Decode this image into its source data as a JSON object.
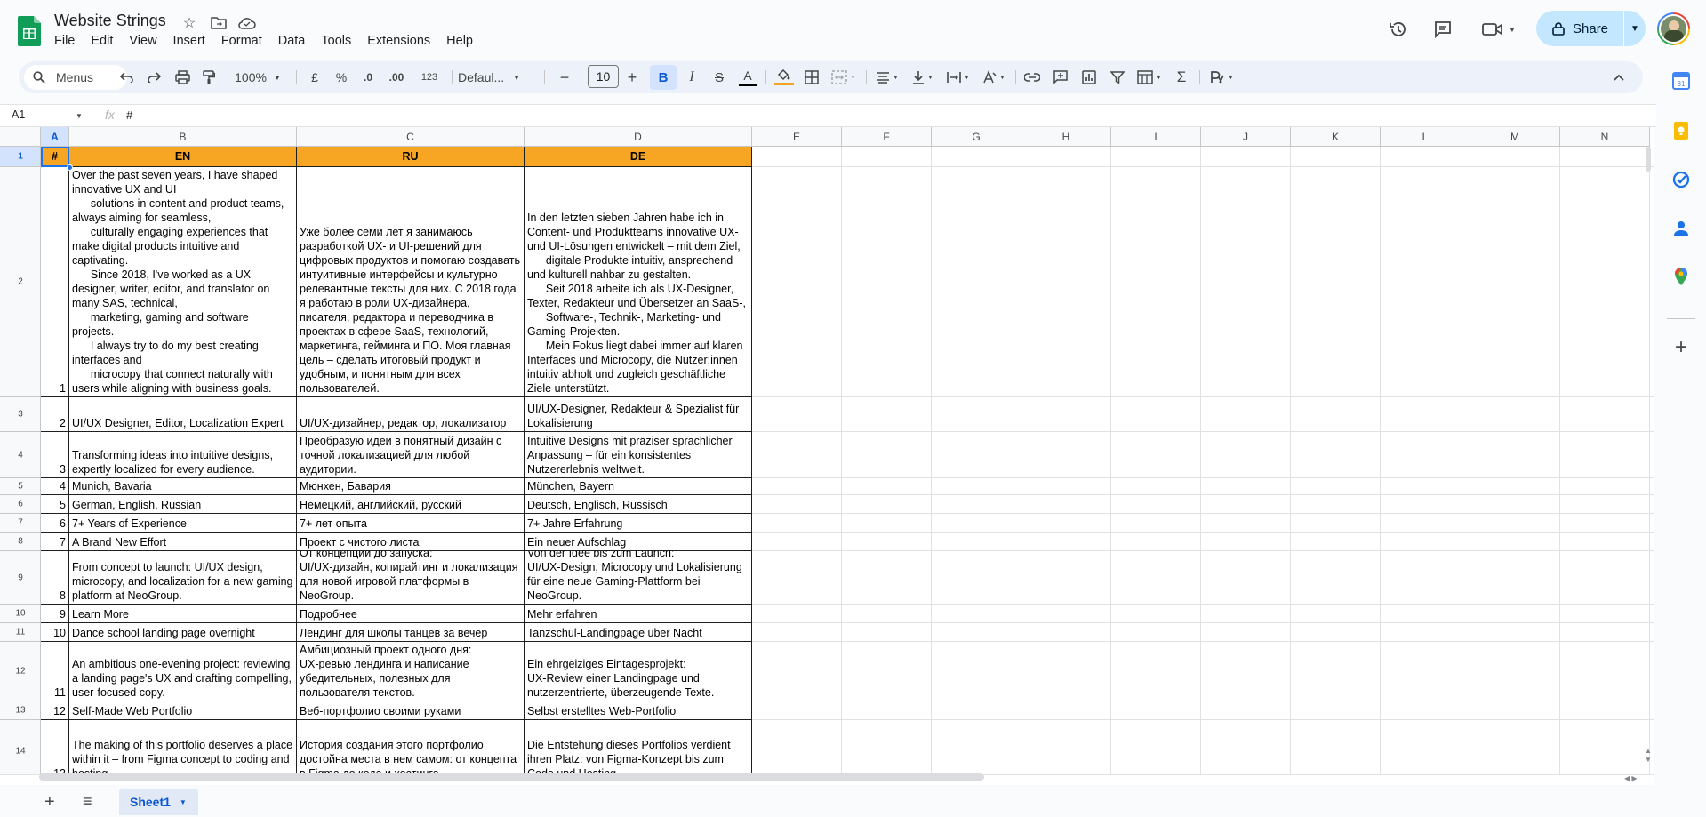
{
  "app": {
    "doc_title": "Website Strings",
    "share_label": "Share"
  },
  "menu": [
    "File",
    "Edit",
    "View",
    "Insert",
    "Format",
    "Data",
    "Tools",
    "Extensions",
    "Help"
  ],
  "toolbar": {
    "search_label": "Menus",
    "zoom": "100%",
    "currency": "£",
    "percent": "%",
    "dec_decrease": ".0",
    "dec_increase": ".00",
    "number_format": "123",
    "font": "Defaul...",
    "font_size": "10",
    "bold": "B",
    "italic": "I",
    "strike": "S",
    "text_color": "A"
  },
  "formula_bar": {
    "name_box": "A1",
    "fx": "fx",
    "value": "#"
  },
  "columns": [
    "A",
    "B",
    "C",
    "D",
    "E",
    "F",
    "G",
    "H",
    "I",
    "J",
    "K",
    "L",
    "M",
    "N"
  ],
  "rows": [
    {
      "n": "1",
      "a": "#",
      "en": "EN",
      "ru": "RU",
      "de": "DE"
    },
    {
      "n": "2",
      "a": "1",
      "en": "Over the past seven years, I have shaped innovative UX and UI\n      solutions in content and product teams, always aiming for seamless,\n      culturally engaging experiences that make digital products intuitive and captivating.\n      Since 2018, I've worked as a UX designer, writer, editor, and translator on many SAS, technical,\n      marketing, gaming and software projects.\n      I always try to do my best creating interfaces and\n      microcopy that connect naturally with users while aligning with business goals.",
      "ru": "Уже более семи лет я занимаюсь разработкой UX- и UI-решений для цифровых продуктов и помогаю создавать интуитивные интерфейсы и культурно релевантные тексты для них. С 2018 года я работаю в роли UX-дизайнера, писателя, редактора и переводчика в проектах в сфере SaaS, технологий, маркетинга, гейминга и ПО. Моя главная цель – сделать итоговый продукт и удобным, и понятным для всех пользователей.",
      "de": "In den letzten sieben Jahren habe ich in Content- und Produktteams innovative UX- und UI-Lösungen entwickelt – mit dem Ziel,\n      digitale Produkte intuitiv, ansprechend und kulturell nahbar zu gestalten.\n      Seit 2018 arbeite ich als UX-Designer, Texter, Redakteur und Übersetzer an SaaS-,\n      Software-, Technik-, Marketing- und Gaming-Projekten.\n      Mein Fokus liegt dabei immer auf klaren Interfaces und Microcopy, die Nutzer:innen intuitiv abholt und zugleich geschäftliche Ziele unterstützt."
    },
    {
      "n": "3",
      "a": "2",
      "en": "UI/UX Designer, Editor, Localization Expert",
      "ru": "UI/UX-дизайнер, редактор, локализатор",
      "de": "UI/UX-Designer, Redakteur & Spezialist für Lokalisierung"
    },
    {
      "n": "4",
      "a": "3",
      "en": "Transforming ideas into intuitive designs, expertly localized for every audience.",
      "ru": "Преобразую идеи в понятный дизайн с точной локализацией для любой аудитории.",
      "de": "Intuitive Designs mit präziser sprachlicher Anpassung – für ein konsistentes Nutzererlebnis weltweit."
    },
    {
      "n": "5",
      "a": "4",
      "en": "Munich, Bavaria",
      "ru": "Мюнхен, Бавария",
      "de": "München, Bayern"
    },
    {
      "n": "6",
      "a": "5",
      "en": "German, English, Russian",
      "ru": "Немецкий, английский, русский",
      "de": "Deutsch, Englisch, Russisch"
    },
    {
      "n": "7",
      "a": "6",
      "en": "7+ Years of Experience",
      "ru": "7+ лет опыта",
      "de": "7+ Jahre Erfahrung"
    },
    {
      "n": "8",
      "a": "7",
      "en": "A Brand New Effort",
      "ru": "Проект с чистого листа",
      "de": "Ein neuer Aufschlag"
    },
    {
      "n": "9",
      "a": "8",
      "en": "From concept to launch: UI/UX design, microcopy, and localization for a new gaming platform at NeoGroup.",
      "ru": "От концепции до запуска:\nUI/UX-дизайн, копирайтинг и локализация для новой игровой платформы в NeoGroup.",
      "de": "Von der Idee bis zum Launch:\nUI/UX-Design, Microcopy und Lokalisierung für eine neue Gaming-Plattform bei NeoGroup."
    },
    {
      "n": "10",
      "a": "9",
      "en": "Learn More",
      "ru": "Подробнее",
      "de": "Mehr erfahren"
    },
    {
      "n": "11",
      "a": "10",
      "en": "Dance school landing page overnight",
      "ru": "Лендинг для школы танцев за вечер",
      "de": "Tanzschul-Landingpage über Nacht"
    },
    {
      "n": "12",
      "a": "11",
      "en": "An ambitious one-evening project: reviewing a landing page's UX and crafting compelling, user-focused copy.",
      "ru": "Амбициозный проект одного дня:\nUX-ревью лендинга и написание убедительных, полезных для пользователя текстов.",
      "de": "Ein ehrgeiziges Eintagesprojekt:\nUX-Review einer Landingpage und nutzerzentrierte, überzeugende Texte."
    },
    {
      "n": "13",
      "a": "12",
      "en": "Self-Made Web Portfolio",
      "ru": "Веб-портфолио своими руками",
      "de": "Selbst erstelltes Web-Portfolio"
    },
    {
      "n": "14",
      "a": "13",
      "en": "The making of this portfolio deserves a place within it – from Figma concept to coding and hosting.",
      "ru": "История создания этого портфолио достойна места в нем самом: от концепта в Figma до кода и хостинга.",
      "de": "Die Entstehung dieses Portfolios verdient ihren Platz: von Figma-Konzept bis zum Code und Hosting."
    }
  ],
  "sheet_tab": "Sheet1",
  "colors": {
    "header_fill": "#f6a623",
    "accent": "#0b57d0",
    "share_bg": "#c2e7ff"
  }
}
